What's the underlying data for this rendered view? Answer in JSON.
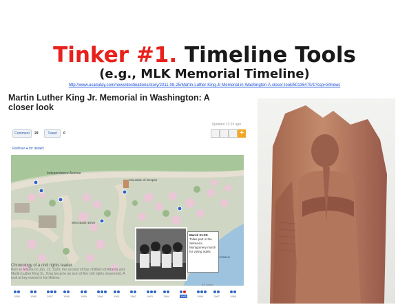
{
  "slide": {
    "title_red": "Tinker #1.",
    "title_black": "Timeline Tools",
    "subtitle": "(e.g., MLK Memorial Timeline)",
    "url": "http://www.usatoday.com/news/destinations/story/2011-08-25/Martin-Luther-King-Jr-Memorial-in-Washington-A-closer-look/50136470/1?csp=34news"
  },
  "article": {
    "title": "Martin Luther King Jr. Memorial in Washington: A closer look",
    "updated": "Updated 12:15 ago",
    "comment_label": "Comment",
    "comment_count": "29",
    "tweet_label": "Tweet",
    "tweet_count": "0",
    "rollover": "Rollover ● for details",
    "map_labels": {
      "avenue": "Independence Avenue",
      "mountain": "Mountain of Despair",
      "west_basin": "West Basin Drive",
      "tidal_basin": "Tidal Basin"
    },
    "chronology_heading": "Chronology of a civil rights leader",
    "chronology_text": "Born in Atlanta on Jan. 15, 1929, the second of four children of Alberta and Martin Luther King Sr., King became an icon of the civil rights movement. A look at key events in his lifetime:",
    "callout_date": "March 21-25:",
    "callout_text": "Tolles part in the Selma-to-Montgomery march for voting rights.",
    "credit": "AP photo",
    "years": [
      "1955",
      "1956",
      "1957",
      "1958",
      "1959",
      "1960",
      "1961",
      "1962",
      "1963",
      "1964",
      "1965",
      "1966",
      "1967",
      "1968"
    ],
    "highlight_year": "1965"
  },
  "colors": {
    "accent_red": "#e8211c",
    "link_blue": "#1a4fd6",
    "dot_blue": "#2f64c6",
    "stone": "#b9785d"
  }
}
